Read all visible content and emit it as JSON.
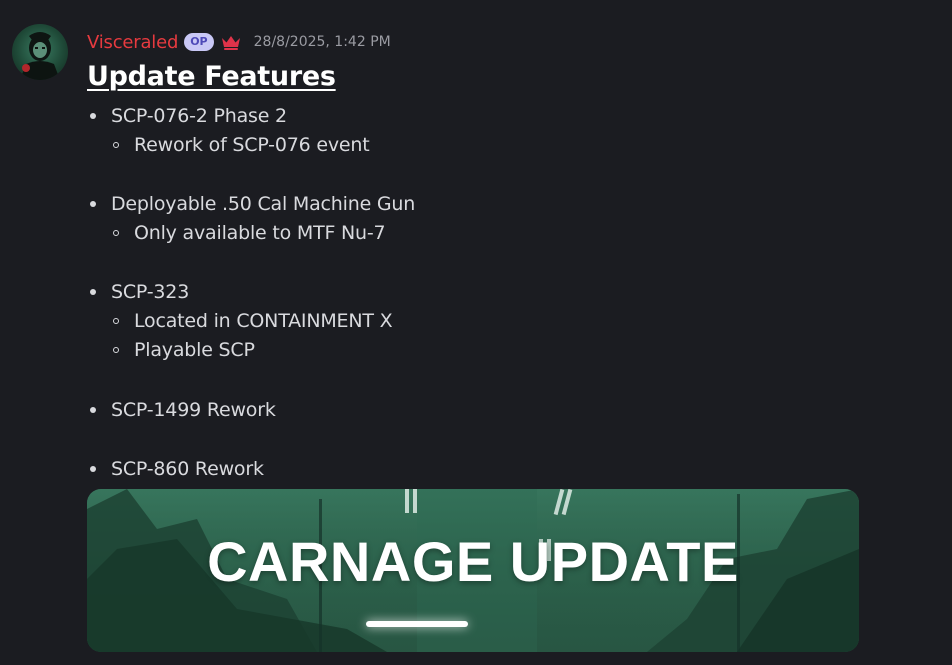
{
  "message": {
    "username": "Visceraled",
    "op_badge": "OP",
    "timestamp": "28/8/2025, 1:42 PM",
    "title": "Update Features",
    "items": [
      {
        "label": "SCP-076-2 Phase 2",
        "sub": [
          "Rework of SCP-076 event"
        ]
      },
      {
        "label": "Deployable .50 Cal Machine Gun",
        "sub": [
          "Only available to MTF Nu-7"
        ]
      },
      {
        "label": "SCP-323",
        "sub": [
          "Located in CONTAINMENT X",
          "Playable SCP"
        ]
      },
      {
        "label": "SCP-1499 Rework",
        "sub": []
      },
      {
        "label": "SCP-860 Rework",
        "sub": []
      }
    ],
    "banner_text": "CARNAGE UPDATE"
  },
  "icons": {
    "avatar": "avatar-icon",
    "crown": "crown-icon"
  },
  "colors": {
    "background": "#1b1c21",
    "username": "#e63a3f",
    "op_badge_bg": "#c9c8f6",
    "op_badge_text": "#4e4ab8",
    "crown": "#e0334a",
    "banner": "#2f6a53"
  }
}
